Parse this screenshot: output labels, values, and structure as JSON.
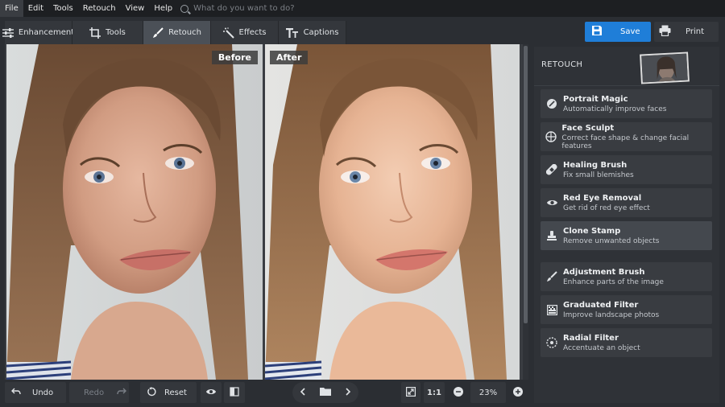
{
  "menubar": {
    "items": [
      "File",
      "Edit",
      "Tools",
      "Retouch",
      "View",
      "Help"
    ],
    "search_placeholder": "What do you want to do?"
  },
  "tabs": [
    {
      "label": "Enhancement",
      "icon": "sliders-icon"
    },
    {
      "label": "Tools",
      "icon": "crop-icon"
    },
    {
      "label": "Retouch",
      "icon": "brush-icon",
      "active": true
    },
    {
      "label": "Effects",
      "icon": "magic-wand-icon"
    },
    {
      "label": "Captions",
      "icon": "text-icon"
    }
  ],
  "actions": {
    "save_label": "Save",
    "print_label": "Print"
  },
  "canvas": {
    "before_label": "Before",
    "after_label": "After"
  },
  "bottom": {
    "undo_label": "Undo",
    "redo_label": "Redo",
    "reset_label": "Reset",
    "zoom_ratio": "1:1",
    "zoom_level": "23%"
  },
  "panel": {
    "title": "RETOUCH",
    "items": [
      {
        "title": "Portrait Magic",
        "subtitle": "Automatically improve faces",
        "icon": "portrait-magic-icon"
      },
      {
        "title": "Face Sculpt",
        "subtitle": "Correct face shape & change facial features",
        "icon": "face-sculpt-icon"
      },
      {
        "title": "Healing Brush",
        "subtitle": "Fix small blemishes",
        "icon": "bandage-icon"
      },
      {
        "title": "Red Eye Removal",
        "subtitle": "Get rid of red eye effect",
        "icon": "eye-icon"
      },
      {
        "title": "Clone Stamp",
        "subtitle": "Remove unwanted objects",
        "icon": "stamp-icon",
        "active": true
      },
      {
        "title": "Adjustment Brush",
        "subtitle": "Enhance parts of the image",
        "icon": "brush-icon"
      },
      {
        "title": "Graduated Filter",
        "subtitle": "Improve landscape photos",
        "icon": "gradient-icon"
      },
      {
        "title": "Radial Filter",
        "subtitle": "Accentuate an object",
        "icon": "radial-icon"
      }
    ]
  },
  "colors": {
    "accent": "#1f7ed8",
    "background": "#2b2e33",
    "panel": "#2f3237"
  }
}
